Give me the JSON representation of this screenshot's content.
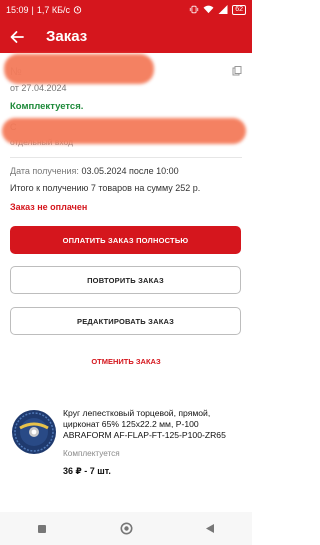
{
  "status_bar": {
    "time": "15:09",
    "network_speed": "1,7 КБ/с",
    "battery": "62",
    "icons": [
      "alarm-icon",
      "vibrate-icon",
      "wifi-icon",
      "signal-icon",
      "battery-icon"
    ]
  },
  "header": {
    "title": "Заказ",
    "back_icon": "arrow-left-icon"
  },
  "order": {
    "date": "от 27.04.2024",
    "state": "Комплектуется.",
    "address_line_2": "отдельный вход"
  },
  "info": {
    "receive_label": "Дата получения:",
    "receive_value": "03.05.2024 после 10:00",
    "total_text": "Итого к получению 7 товаров на сумму 252 р.",
    "payment_status": "Заказ не оплачен"
  },
  "actions": {
    "pay_label": "ОПЛАТИТЬ ЗАКАЗ ПОЛНОСТЬЮ",
    "repeat_label": "ПОВТОРИТЬ ЗАКАЗ",
    "edit_label": "РЕДАКТИРОВАТЬ ЗАКАЗ",
    "cancel_label": "ОТМЕНИТЬ ЗАКАЗ"
  },
  "product": {
    "name": "Круг лепестковый торцевой, прямой, цирконат 65% 125х22.2 мм, Р-100 ABRAFORM AF-FLAP-FT-125-P100-ZR65",
    "status": "Комплектуется",
    "price": "36 ₽ - 7 шт."
  },
  "colors": {
    "brand_red": "#d5161d",
    "status_green": "#1e8a3a"
  },
  "nav": {
    "icons": [
      "recents-square-icon",
      "home-circle-icon",
      "back-triangle-icon"
    ]
  }
}
